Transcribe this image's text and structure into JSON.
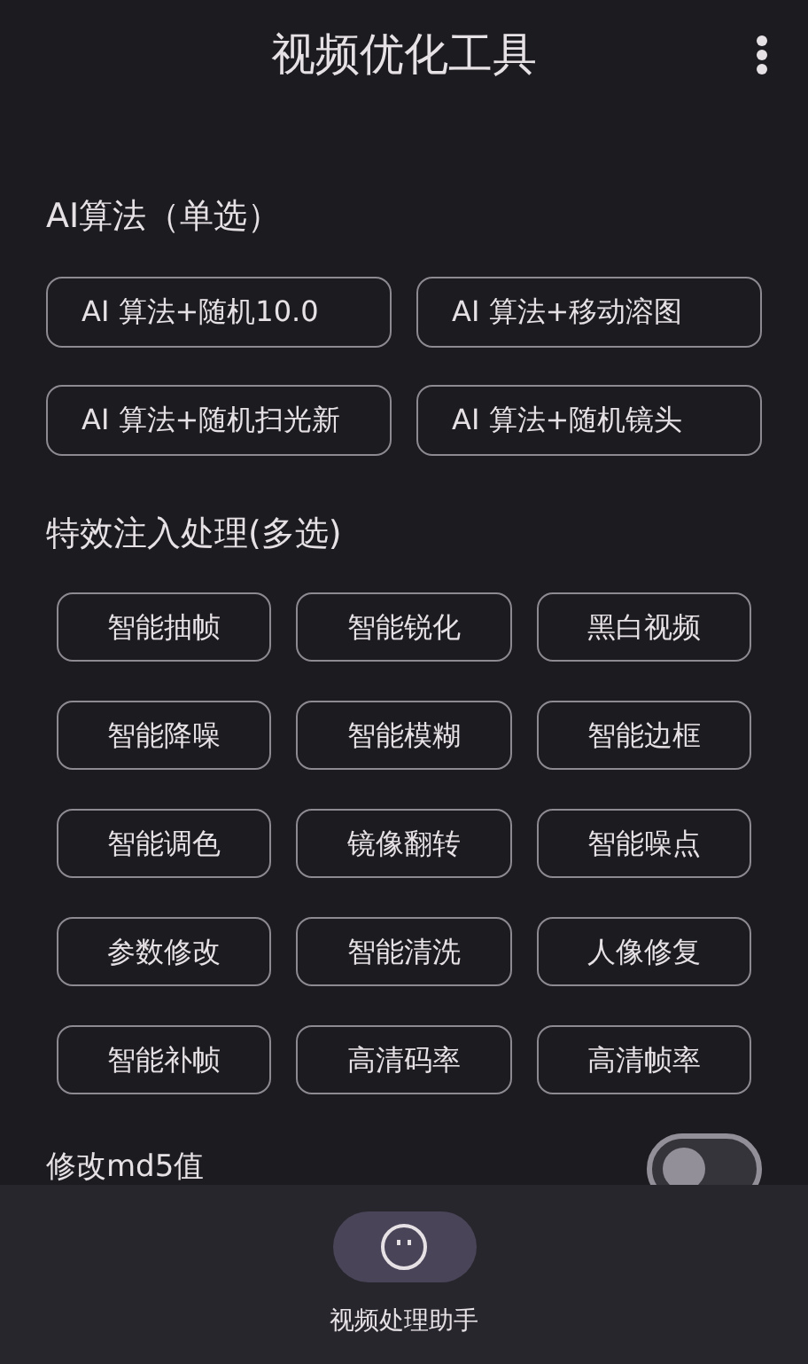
{
  "app_bar": {
    "title": "视频优化工具"
  },
  "sections": [
    {
      "title": "AI算法（单选）",
      "kind": "single",
      "options": [
        {
          "label": "AI 算法+随机10.0",
          "selected": false
        },
        {
          "label": "AI 算法+移动溶图",
          "selected": false
        },
        {
          "label": "AI 算法+随机扫光新",
          "selected": false
        },
        {
          "label": "AI 算法+随机镜头",
          "selected": false
        }
      ]
    },
    {
      "title": "特效注入处理(多选)",
      "kind": "multi",
      "options": [
        {
          "label": "智能抽帧",
          "selected": false
        },
        {
          "label": "智能锐化",
          "selected": false
        },
        {
          "label": "黑白视频",
          "selected": false
        },
        {
          "label": "智能降噪",
          "selected": false
        },
        {
          "label": "智能模糊",
          "selected": false
        },
        {
          "label": "智能边框",
          "selected": false
        },
        {
          "label": "智能调色",
          "selected": false
        },
        {
          "label": "镜像翻转",
          "selected": false
        },
        {
          "label": "智能噪点",
          "selected": false
        },
        {
          "label": "参数修改",
          "selected": false
        },
        {
          "label": "智能清洗",
          "selected": false
        },
        {
          "label": "人像修复",
          "selected": false
        },
        {
          "label": "智能补帧",
          "selected": false
        },
        {
          "label": "高清码率",
          "selected": false
        },
        {
          "label": "高清帧率",
          "selected": false
        }
      ]
    }
  ],
  "switch_row": {
    "label": "修改md5值",
    "on": false
  },
  "bottom_nav": [
    {
      "label": "视频处理助手",
      "selected": true
    }
  ]
}
